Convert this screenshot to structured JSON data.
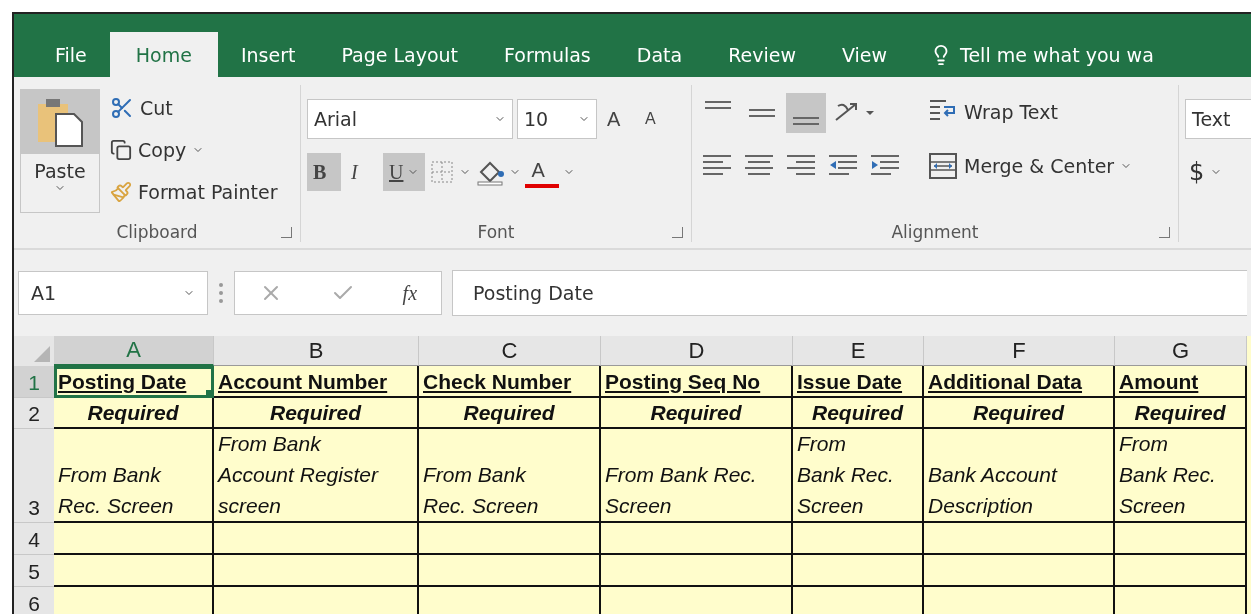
{
  "ribbon_tabs": [
    {
      "label": "File",
      "selected": false
    },
    {
      "label": "Home",
      "selected": true
    },
    {
      "label": "Insert",
      "selected": false
    },
    {
      "label": "Page Layout",
      "selected": false
    },
    {
      "label": "Formulas",
      "selected": false
    },
    {
      "label": "Data",
      "selected": false
    },
    {
      "label": "Review",
      "selected": false
    },
    {
      "label": "View",
      "selected": false
    }
  ],
  "tell_me": {
    "placeholder": "Tell me what you wa"
  },
  "clipboard": {
    "paste": "Paste",
    "cut": "Cut",
    "copy": "Copy",
    "format_painter": "Format Painter",
    "label": "Clipboard"
  },
  "font": {
    "name": "Arial",
    "size": "10",
    "grow": "A",
    "shrink": "A",
    "bold": {
      "label": "B",
      "on": true
    },
    "italic": {
      "label": "I",
      "on": false
    },
    "underline": {
      "label": "U",
      "on": true
    },
    "font_color": "A",
    "label": "Font"
  },
  "alignment": {
    "valign": [
      {
        "selected": false
      },
      {
        "selected": false
      },
      {
        "selected": true
      }
    ],
    "wrap_text": "Wrap Text",
    "merge_center": "Merge & Center",
    "label": "Alignment"
  },
  "number": {
    "format": "Text",
    "currency": "$"
  },
  "formula_bar": {
    "name_box": "A1",
    "fx": "fx",
    "value": "Posting Date"
  },
  "sheet": {
    "columns": [
      {
        "label": "A",
        "selected": true
      },
      {
        "label": "B",
        "selected": false
      },
      {
        "label": "C",
        "selected": false
      },
      {
        "label": "D",
        "selected": false
      },
      {
        "label": "E",
        "selected": false
      },
      {
        "label": "F",
        "selected": false
      },
      {
        "label": "G",
        "selected": false
      }
    ],
    "rows": [
      {
        "label": "1",
        "kind": "header",
        "selected": true,
        "cells": [
          "Posting Date",
          "Account Number",
          "Check Number",
          "Posting Seq No",
          "Issue Date",
          "Additional Data",
          "Amount"
        ]
      },
      {
        "label": "2",
        "kind": "required",
        "selected": false,
        "cells": [
          "Required",
          "Required",
          "Required",
          "Required",
          "Required",
          "Required",
          "Required"
        ]
      },
      {
        "label": "3",
        "kind": "note",
        "selected": false,
        "cells": [
          [
            "From Bank",
            "Rec. Screen"
          ],
          [
            "From Bank",
            "Account Register",
            "screen"
          ],
          [
            "From Bank",
            "Rec. Screen"
          ],
          [
            "From Bank Rec.",
            "Screen"
          ],
          [
            "From",
            "Bank Rec.",
            "Screen"
          ],
          [
            "Bank Account",
            "Description"
          ],
          [
            "From",
            "Bank Rec.",
            "Screen"
          ]
        ]
      },
      {
        "label": "4",
        "kind": "empty",
        "selected": false,
        "cells": [
          "",
          "",
          "",
          "",
          "",
          "",
          ""
        ]
      },
      {
        "label": "5",
        "kind": "empty",
        "selected": false,
        "cells": [
          "",
          "",
          "",
          "",
          "",
          "",
          ""
        ]
      },
      {
        "label": "6",
        "kind": "empty",
        "selected": false,
        "cells": [
          "",
          "",
          "",
          "",
          "",
          "",
          ""
        ]
      }
    ]
  }
}
